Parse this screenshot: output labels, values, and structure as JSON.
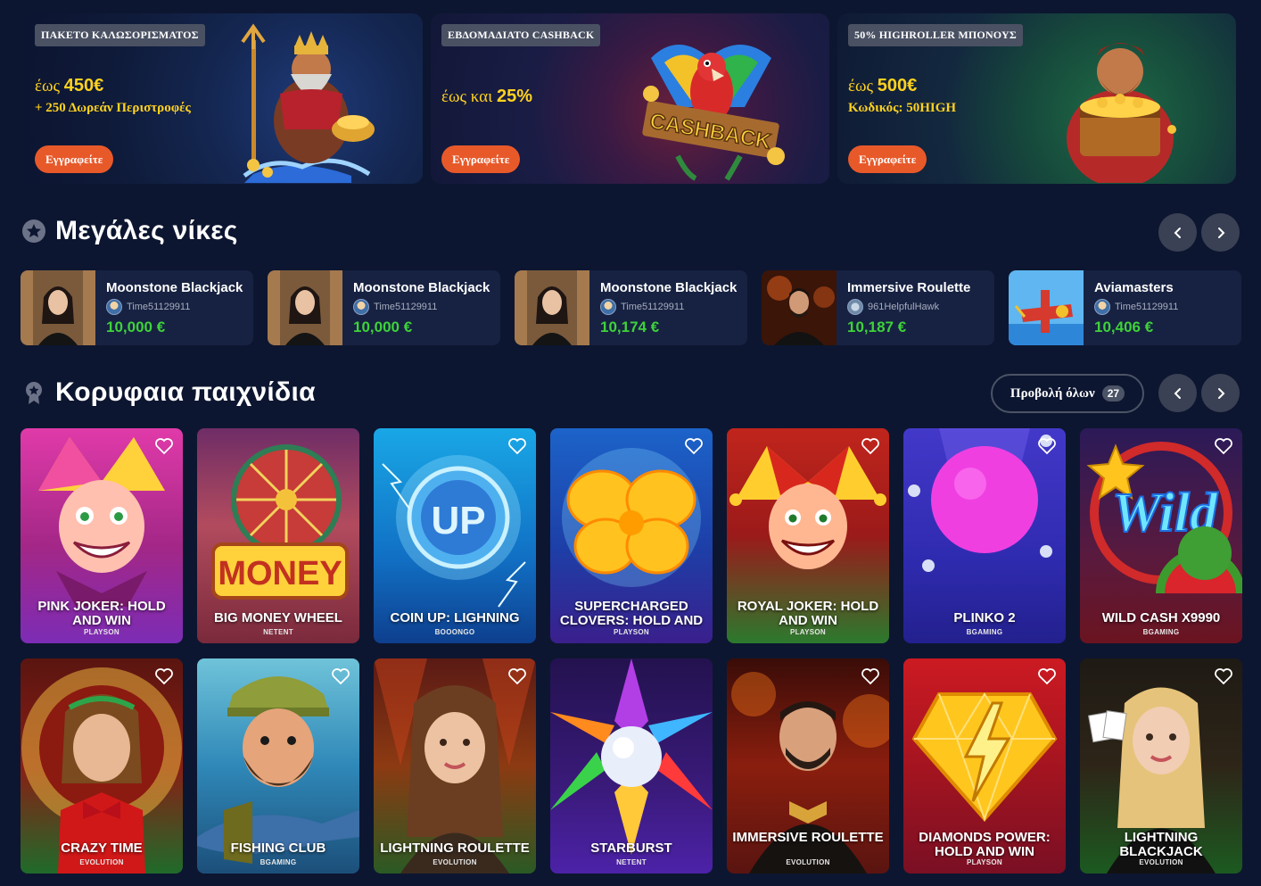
{
  "promos": [
    {
      "badge": "ΠΑΚΕΤΟ ΚΑΛΩΣΟΡΙΣΜΑΤΟΣ",
      "prefix": "έως",
      "amount": "450€",
      "sub": "+ 250 Δωρεάν Περιστροφές",
      "cta": "Εγγραφείτε"
    },
    {
      "badge": "ΕΒΔΟΜΑΔΙΑΤΟ CASHBACK",
      "prefix": "έως και",
      "amount": "25%",
      "sub": "",
      "cta": "Εγγραφείτε",
      "art_text": "CASHBACK"
    },
    {
      "badge": "50% HIGHROLLER ΜΠΟΝΟΥΣ",
      "prefix": "έως",
      "amount": "500€",
      "sub": "Κωδικός: 50HIGH",
      "cta": "Εγγραφείτε"
    }
  ],
  "big_wins": {
    "title": "Μεγάλες νίκες",
    "items": [
      {
        "game": "Moonstone Blackjack",
        "user": "Time51129911",
        "amount": "10,000 €"
      },
      {
        "game": "Moonstone Blackjack",
        "user": "Time51129911",
        "amount": "10,000 €"
      },
      {
        "game": "Moonstone Blackjack",
        "user": "Time51129911",
        "amount": "10,174 €"
      },
      {
        "game": "Immersive Roulette",
        "user": "961HelpfulHawk",
        "amount": "10,187 €"
      },
      {
        "game": "Aviamasters",
        "user": "Time51129911",
        "amount": "10,406 €"
      }
    ]
  },
  "top_games": {
    "title": "Κορυφαια παιχνίδια",
    "view_all": "Προβολή όλων",
    "count": "27",
    "games": [
      {
        "title": "PINK JOKER: HOLD AND WIN",
        "provider": "PLAYSON"
      },
      {
        "title": "BIG MONEY WHEEL",
        "provider": "NETENT"
      },
      {
        "title": "COIN UP: LIGHNING",
        "provider": "BOOONGO"
      },
      {
        "title": "SUPERCHARGED CLOVERS: HOLD AND",
        "provider": "PLAYSON"
      },
      {
        "title": "ROYAL JOKER: HOLD AND WIN",
        "provider": "PLAYSON"
      },
      {
        "title": "PLINKO 2",
        "provider": "BGAMING"
      },
      {
        "title": "WILD CASH X9990",
        "provider": "BGAMING"
      },
      {
        "title": "CRAZY TIME",
        "provider": "EVOLUTION"
      },
      {
        "title": "FISHING CLUB",
        "provider": "BGAMING"
      },
      {
        "title": "LIGHTNING ROULETTE",
        "provider": "EVOLUTION"
      },
      {
        "title": "STARBURST",
        "provider": "NETENT"
      },
      {
        "title": "IMMERSIVE ROULETTE",
        "provider": "EVOLUTION"
      },
      {
        "title": "DIAMONDS POWER: HOLD AND WIN",
        "provider": "PLAYSON"
      },
      {
        "title": "LIGHTNING BLACKJACK",
        "provider": "EVOLUTION"
      }
    ]
  },
  "colors": {
    "background": "#0d1630",
    "accent": "#e8592a",
    "gold": "#ffd21f",
    "win_green": "#3fd23a",
    "card": "#172242"
  }
}
